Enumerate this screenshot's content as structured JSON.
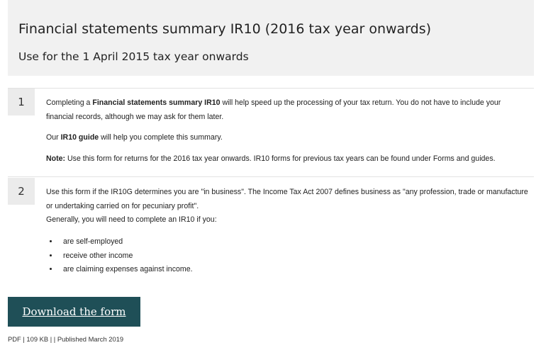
{
  "header": {
    "title": "Financial statements summary IR10 (2016 tax year onwards)",
    "subtitle": "Use for the 1 April 2015 tax year onwards"
  },
  "steps": [
    {
      "number": "1",
      "p1_before": "Completing a ",
      "p1_bold": "Financial statements summary IR10",
      "p1_after": " will help speed up the processing of your tax return. You do not have to include your financial records, although we may ask for them later.",
      "p2_before": "Our ",
      "p2_bold": "IR10 guide",
      "p2_after": " will help you complete this summary.",
      "p3_bold": "Note:",
      "p3_after": " Use this form for returns for the 2016 tax year onwards. IR10 forms for previous tax years can be found under Forms and guides."
    },
    {
      "number": "2",
      "p1": "Use this form if the IR10G determines you are \"in business\". The Income Tax Act 2007 defines business as \"any profession, trade or manufacture or undertaking carried on for pecuniary profit\".",
      "p2": "Generally, you will need to complete an IR10 if you:",
      "items": [
        "are self-employed",
        "receive other income",
        "are claiming expenses against income."
      ]
    }
  ],
  "download": {
    "label": "Download the form",
    "meta": "PDF | 109 KB | | Published March 2019"
  },
  "colors": {
    "header_bg": "#f1f1f1",
    "button_bg": "#1f4f57"
  }
}
